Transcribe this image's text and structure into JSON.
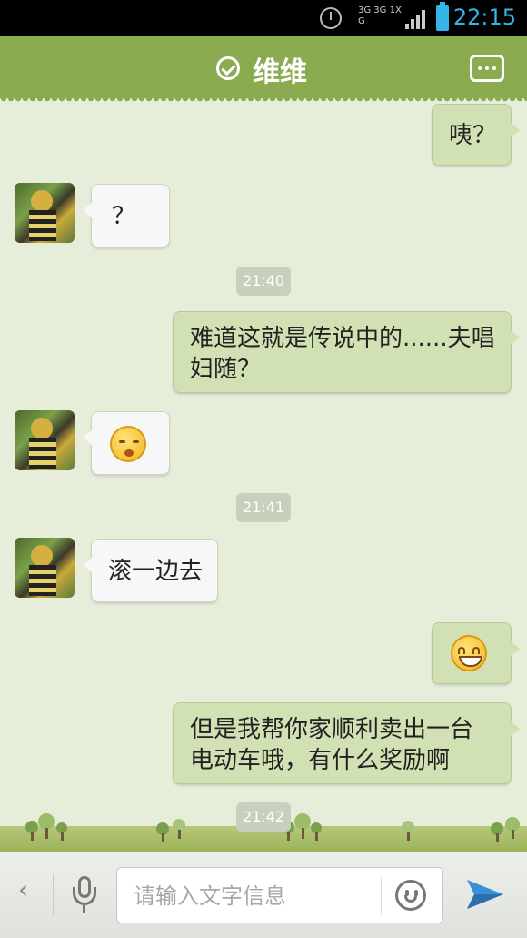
{
  "status_bar": {
    "time": "22:15",
    "network_label": "3G 3G 1X G",
    "icons": [
      "alarm-icon",
      "network-icon",
      "signal-icon",
      "battery-icon"
    ],
    "accent_color": "#33b5e5"
  },
  "header": {
    "title": "维维",
    "verified_icon": "check-circle-icon",
    "more_icon": "more-dots-icon",
    "color": "#8aab4f"
  },
  "messages": [
    {
      "side": "right",
      "type": "text",
      "text": "咦？"
    },
    {
      "side": "left",
      "type": "text",
      "text": "？"
    },
    {
      "type": "time",
      "text": "21:40"
    },
    {
      "side": "right",
      "type": "text",
      "lines": [
        "难道这就是传说中的......夫唱",
        "妇随？"
      ]
    },
    {
      "side": "left",
      "type": "emoji",
      "emoji": "shy-smile-emoji"
    },
    {
      "type": "time",
      "text": "21:41"
    },
    {
      "side": "left",
      "type": "text",
      "text": "滚一边去"
    },
    {
      "side": "right",
      "type": "emoji",
      "emoji": "grin-emoji"
    },
    {
      "side": "right",
      "type": "text",
      "lines": [
        "但是我帮你家顺利卖出一台",
        "电动车哦，有什么奖励啊"
      ]
    },
    {
      "type": "time",
      "text": "21:42"
    }
  ],
  "input_bar": {
    "back_icon": "chevron-left-icon",
    "back_glyph": "‹",
    "mic_icon": "microphone-icon",
    "placeholder": "请输入文字信息",
    "emoji_icon": "smiley-icon",
    "send_icon": "send-plane-icon"
  }
}
